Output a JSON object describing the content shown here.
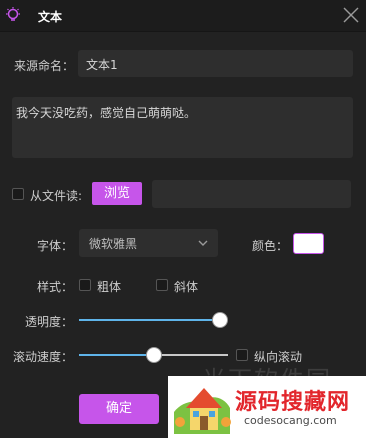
{
  "window": {
    "title": "文本"
  },
  "source_name": {
    "label": "来源命名：",
    "value": "文本1"
  },
  "text_content": {
    "value": "我今天没吃药，感觉自己萌萌哒。"
  },
  "from_file": {
    "label": "从文件读:",
    "browse_label": "浏览",
    "checked": false
  },
  "font": {
    "label": "字体：",
    "selected": "微软雅黑"
  },
  "color": {
    "label": "颜色：",
    "value": "#ffffff"
  },
  "style": {
    "label": "样式：",
    "bold_label": "粗体",
    "italic_label": "斜体",
    "bold_checked": false,
    "italic_checked": false
  },
  "opacity": {
    "label": "透明度：",
    "value_fraction": 1.0
  },
  "scroll_speed": {
    "label": "滚动速度：",
    "value_fraction": 0.5,
    "vertical_label": "纵向滚动",
    "vertical_checked": false
  },
  "footer": {
    "ok_label": "确定"
  },
  "watermark": {
    "faint_text": "光下软件园",
    "brand_text": "源码搜藏网",
    "url": "codesocang.com"
  },
  "colors": {
    "accent": "#c655ea",
    "slider_fill": "#5fb4ea",
    "background": "#222222",
    "field_bg": "#2e2e2e"
  },
  "icons": {
    "app": "lightbulb-icon",
    "close": "close-icon",
    "dropdown": "chevron-down-icon"
  }
}
